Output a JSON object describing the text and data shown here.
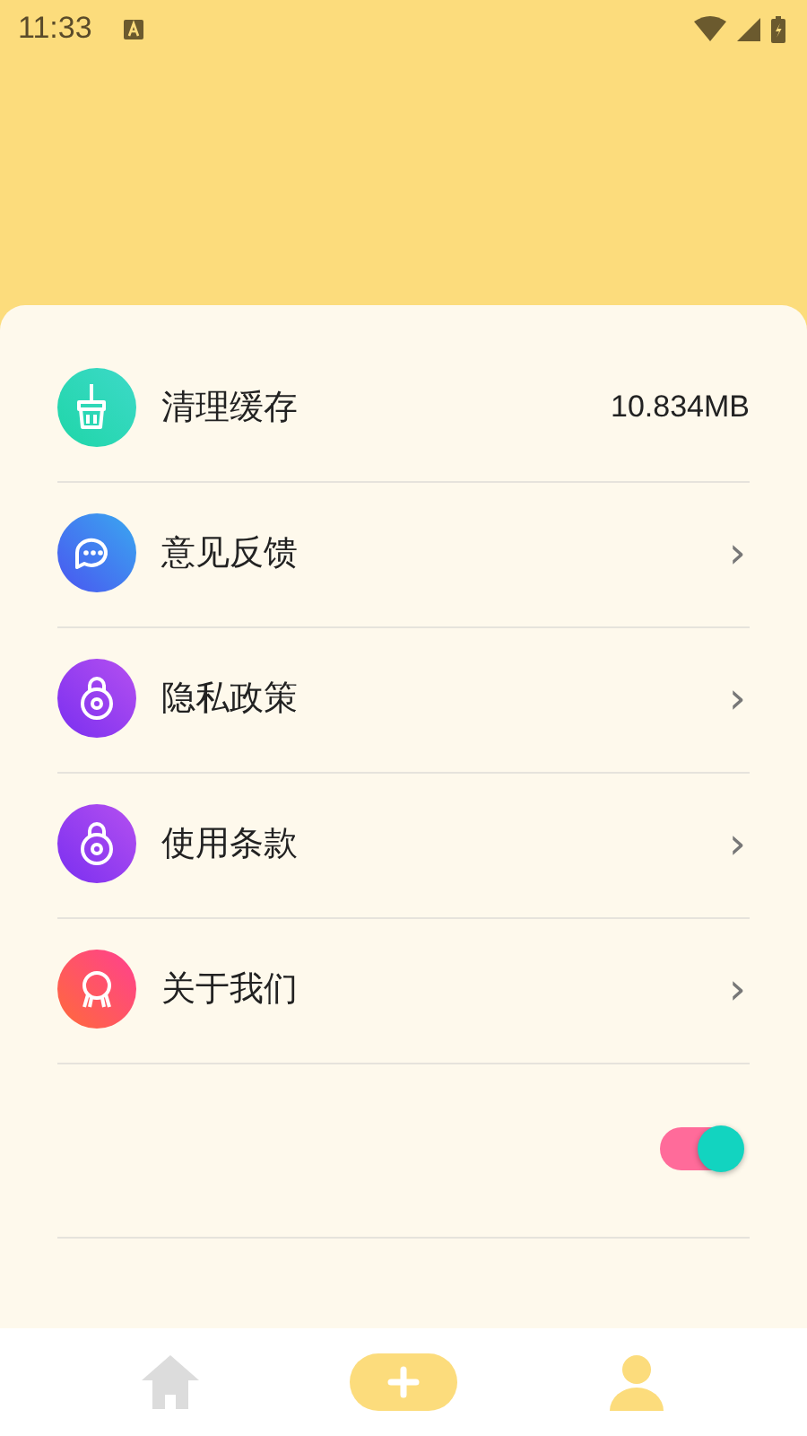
{
  "status_bar": {
    "time": "11:33"
  },
  "settings": [
    {
      "kind": "value",
      "label": "清理缓存",
      "value": "10.834MB"
    },
    {
      "kind": "link",
      "label": "意见反馈",
      "arrow": "›"
    },
    {
      "kind": "link",
      "label": "隐私政策",
      "arrow": "›"
    },
    {
      "kind": "link",
      "label": "使用条款",
      "arrow": "›"
    },
    {
      "kind": "link",
      "label": "关于我们",
      "arrow": "›"
    },
    {
      "kind": "toggle",
      "on": true
    }
  ],
  "bottom_nav": [
    {
      "kind": "home",
      "selected": false
    },
    {
      "kind": "add",
      "selected": false
    },
    {
      "kind": "profile",
      "selected": true
    }
  ]
}
